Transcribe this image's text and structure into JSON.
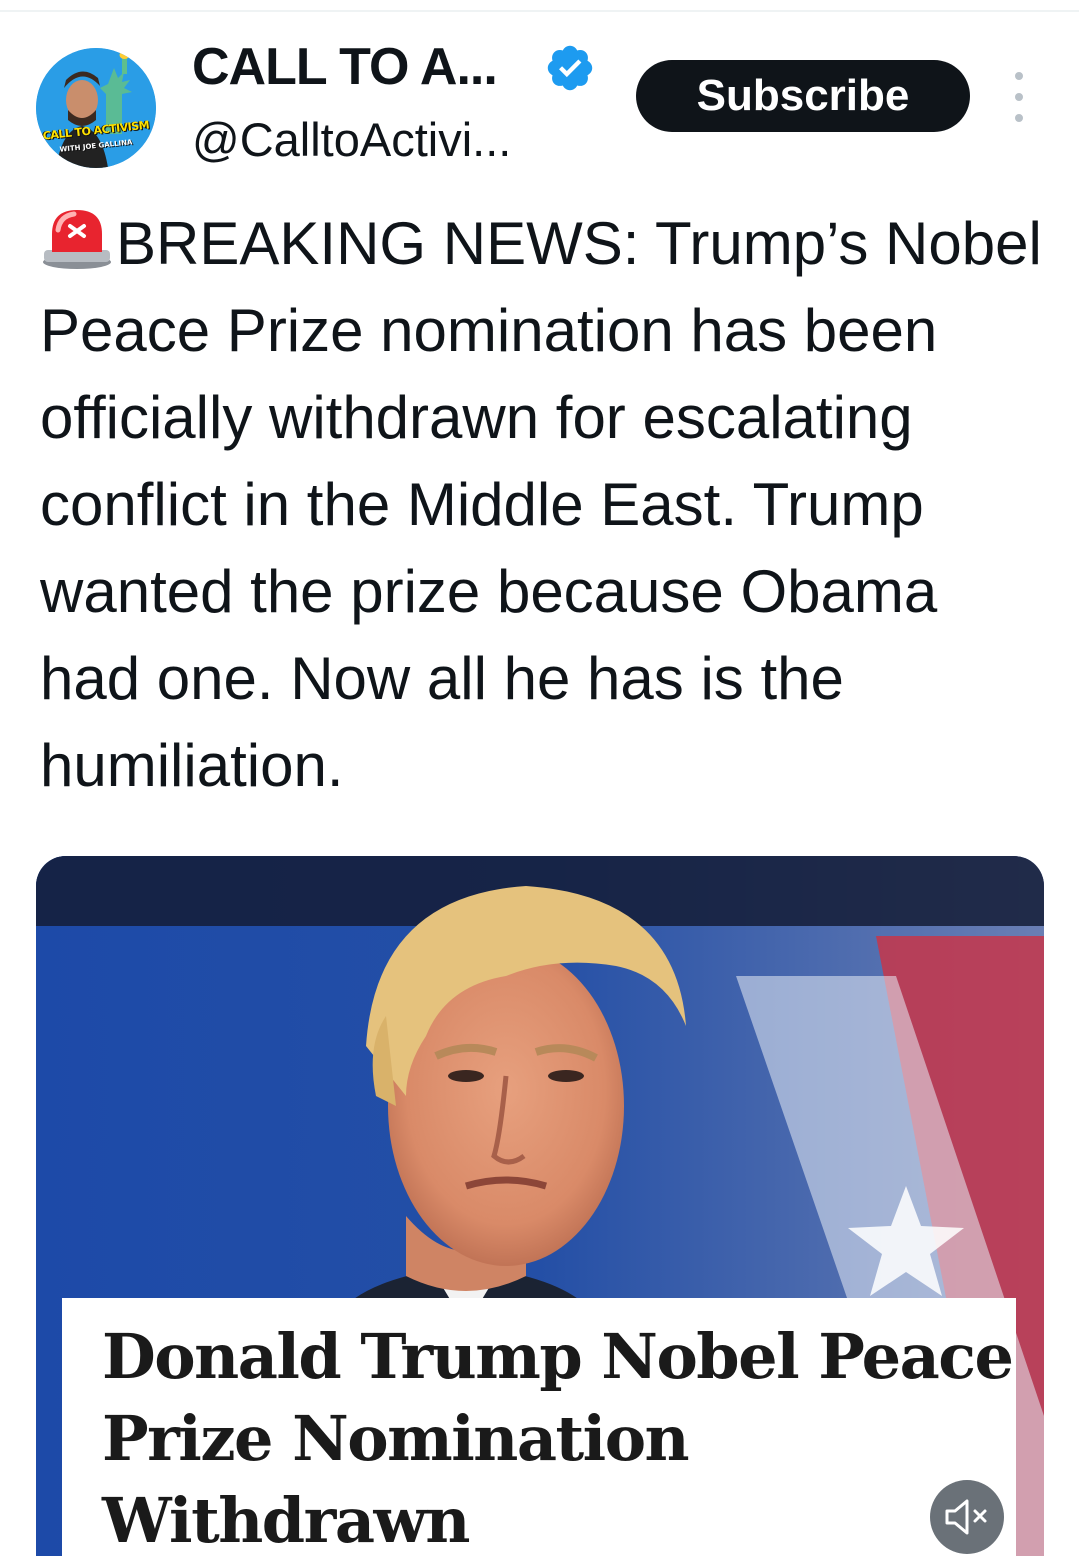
{
  "account": {
    "display_name": "CALL TO A...",
    "handle": "@CalltoActivi...",
    "avatar_text": "CALL TO ACTIVISM",
    "avatar_subtext": "WITH JOE GALLINA",
    "verified": true
  },
  "actions": {
    "subscribe_label": "Subscribe",
    "more_icon": "more-vertical-icon"
  },
  "tweet": {
    "emoji": "rotating-light-icon",
    "text": "BREAKING NEWS: Trump’s Nobel Peace Prize nomination has been officially withdrawn for escalating conflict in the Middle East. Trump wanted the prize because Obama had one. Now all he has is the humiliation."
  },
  "media": {
    "caption_headline": "Donald Trump Nobel Peace Prize Nomination Withdrawn",
    "mute_icon": "speaker-muted-icon"
  },
  "colors": {
    "text": "#0f1419",
    "button_bg": "#0f1419",
    "verified_blue": "#1d9bf0"
  }
}
